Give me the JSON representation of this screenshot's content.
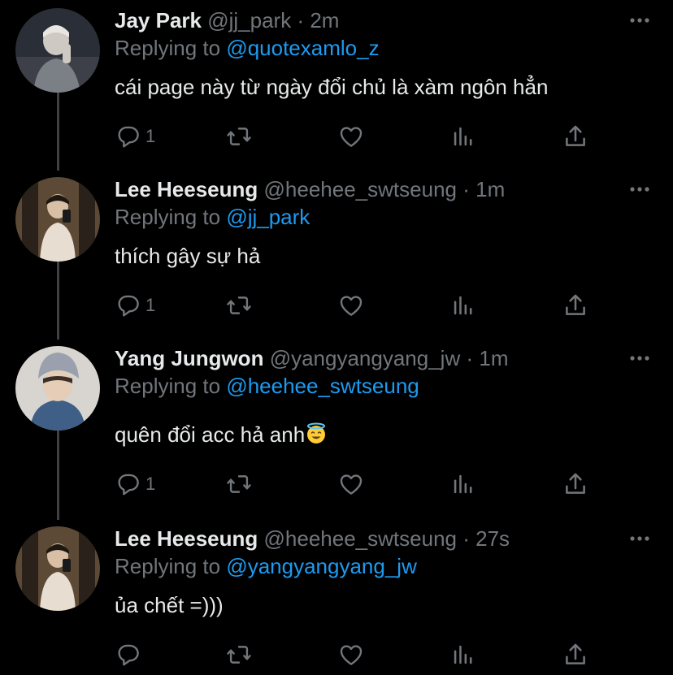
{
  "colors": {
    "background": "#000000",
    "text": "#e7e9ea",
    "secondary": "#71767b",
    "accent": "#1d9bf0",
    "thread_line": "#3e4144"
  },
  "replying_label": "Replying to",
  "tweets": [
    {
      "name": "Jay Park",
      "handle": "@jj_park",
      "time": "2m",
      "replying_to": "@quotexamlo_z",
      "text": "cái page này từ ngày đổi chủ là xàm ngôn hẳn",
      "reply_count": "1",
      "avatar_icon": "avatar-photo"
    },
    {
      "name": "Lee Heeseung",
      "handle": "@heehee_swtseung",
      "time": "1m",
      "replying_to": "@jj_park",
      "text": "thích gây sự hả",
      "reply_count": "1",
      "avatar_icon": "avatar-photo"
    },
    {
      "name": "Yang Jungwon",
      "handle": "@yangyangyang_jw",
      "time": "1m",
      "replying_to": "@heehee_swtseung",
      "text": "quên đổi acc hả anh",
      "text_emoji": "smiling-face-with-halo-emoji",
      "reply_count": "1",
      "avatar_icon": "avatar-photo"
    },
    {
      "name": "Lee Heeseung",
      "handle": "@heehee_swtseung",
      "time": "27s",
      "replying_to": "@yangyangyang_jw",
      "text": "ủa chết =)))",
      "reply_count": "",
      "avatar_icon": "avatar-photo"
    }
  ],
  "action_icons": [
    "reply-icon",
    "retweet-icon",
    "like-icon",
    "analytics-icon",
    "share-icon"
  ],
  "separator": "·"
}
